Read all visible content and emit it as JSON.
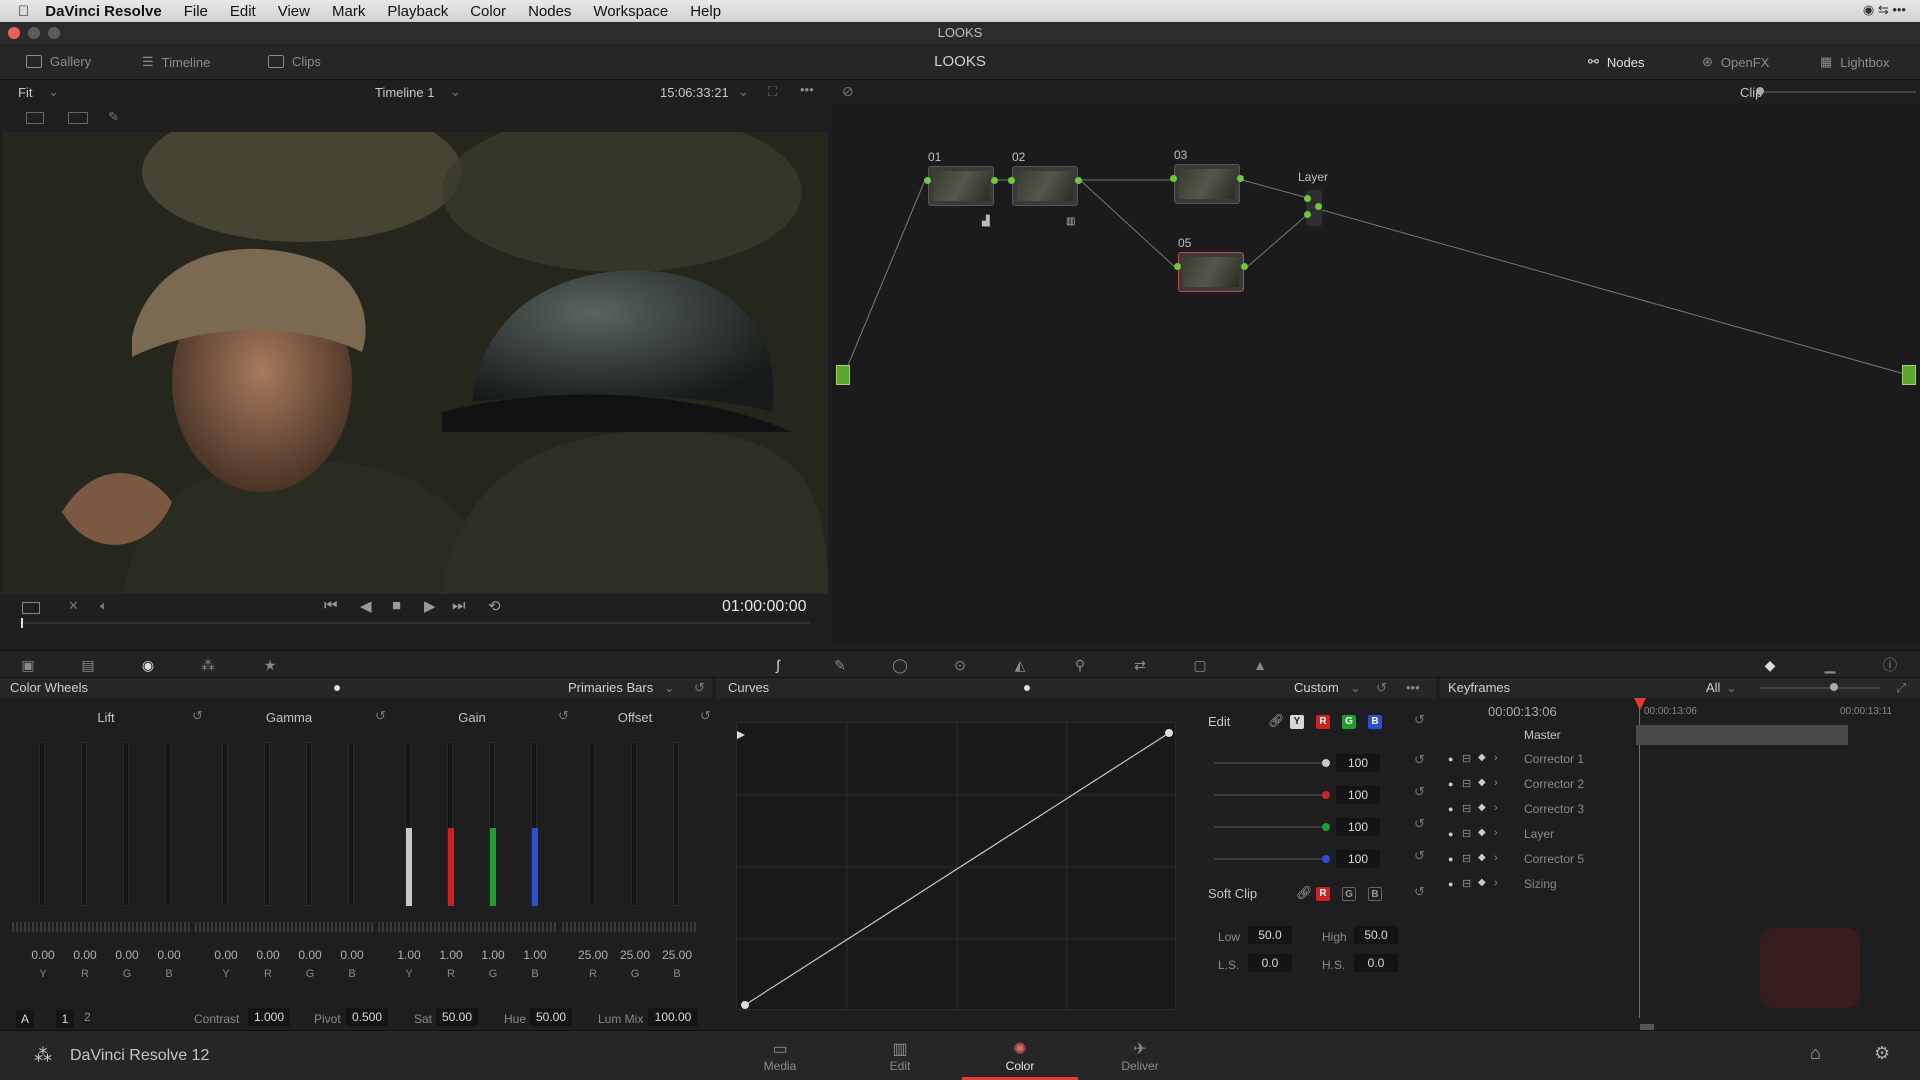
{
  "menubar": {
    "app": "DaVinci Resolve",
    "items": [
      "File",
      "Edit",
      "View",
      "Mark",
      "Playback",
      "Color",
      "Nodes",
      "Workspace",
      "Help"
    ]
  },
  "window": {
    "title": "LOOKS"
  },
  "topbar": {
    "gallery": "Gallery",
    "timeline": "Timeline",
    "clips": "Clips",
    "page_title": "LOOKS",
    "nodes": "Nodes",
    "openfx": "OpenFX",
    "lightbox": "Lightbox"
  },
  "viewer": {
    "fit": "Fit",
    "timeline_name": "Timeline 1",
    "timecode": "15:06:33:21",
    "playhead_timecode": "01:00:00:00",
    "clip_mode": "Clip"
  },
  "nodes": {
    "n01": "01",
    "n02": "02",
    "n03": "03",
    "n05": "05",
    "layer": "Layer"
  },
  "color_wheels": {
    "title": "Color Wheels",
    "mode": "Primaries Bars",
    "wheels": [
      {
        "name": "Lift",
        "values": [
          "0.00",
          "0.00",
          "0.00",
          "0.00"
        ],
        "channels": [
          "Y",
          "R",
          "G",
          "B"
        ]
      },
      {
        "name": "Gamma",
        "values": [
          "0.00",
          "0.00",
          "0.00",
          "0.00"
        ],
        "channels": [
          "Y",
          "R",
          "G",
          "B"
        ]
      },
      {
        "name": "Gain",
        "values": [
          "1.00",
          "1.00",
          "1.00",
          "1.00"
        ],
        "channels": [
          "Y",
          "R",
          "G",
          "B"
        ]
      },
      {
        "name": "Offset",
        "values": [
          "25.00",
          "25.00",
          "25.00"
        ],
        "channels": [
          "R",
          "G",
          "B"
        ]
      }
    ],
    "footer": {
      "a": "A",
      "p1": "1",
      "p2": "2",
      "contrast_label": "Contrast",
      "contrast": "1.000",
      "pivot_label": "Pivot",
      "pivot": "0.500",
      "sat_label": "Sat",
      "sat": "50.00",
      "hue_label": "Hue",
      "hue": "50.00",
      "lummix_label": "Lum Mix",
      "lummix": "100.00"
    }
  },
  "curves": {
    "title": "Curves",
    "mode": "Custom",
    "edit_label": "Edit",
    "channel_buttons": [
      "Y",
      "R",
      "G",
      "B"
    ],
    "channel_values": [
      "100",
      "100",
      "100",
      "100"
    ],
    "softclip": {
      "label": "Soft Clip",
      "buttons": [
        "R",
        "G",
        "B"
      ],
      "low_label": "Low",
      "low": "50.0",
      "high_label": "High",
      "high": "50.0",
      "ls_label": "L.S.",
      "ls": "0.0",
      "hs_label": "H.S.",
      "hs": "0.0"
    }
  },
  "keyframes": {
    "title": "Keyframes",
    "filter": "All",
    "current_tc": "00:00:13:06",
    "ruler_start": "00:00:13:06",
    "ruler_end": "00:00:13:11",
    "master": "Master",
    "tracks": [
      "Corrector 1",
      "Corrector 2",
      "Corrector 3",
      "Layer",
      "Corrector 5",
      "Sizing"
    ]
  },
  "bottombar": {
    "app_name": "DaVinci Resolve 12",
    "pages": [
      "Media",
      "Edit",
      "Color",
      "Deliver"
    ],
    "active_page": "Color"
  },
  "colors": {
    "accent": "#e63b2e",
    "node_link": "#6fc93a",
    "red": "#d02020",
    "green": "#1f9d2e",
    "blue": "#2a50d0"
  }
}
